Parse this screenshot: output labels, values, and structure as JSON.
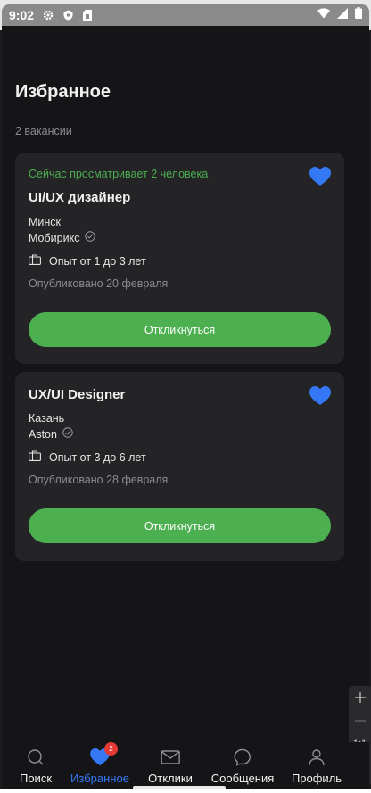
{
  "status_bar": {
    "time": "9:02",
    "left_icons": [
      "gear-icon",
      "shield-icon",
      "sim-card-icon"
    ],
    "right_icons": [
      "wifi-icon",
      "signal-icon",
      "battery-icon"
    ]
  },
  "page": {
    "title": "Избранное",
    "count": "2 вакансии"
  },
  "vacancies": [
    {
      "viewing": "Сейчас просматривает 2 человека",
      "title": "UI/UX дизайнер",
      "city": "Минск",
      "company": "Мобирикс",
      "experience": "Опыт от 1 до 3 лет",
      "published": "Опубликовано 20 февраля",
      "favorite": true,
      "button": "Откликнуться"
    },
    {
      "title": "UX/UI Designer",
      "city": "Казань",
      "company": "Aston",
      "experience": "Опыт от 3 до 6 лет",
      "published": "Опубликовано 28 февраля",
      "favorite": true,
      "button": "Откликнуться"
    }
  ],
  "zoom_panel": {
    "ratio": "1:1"
  },
  "bottom_nav": {
    "items": [
      {
        "label": "Поиск",
        "icon": "search-icon"
      },
      {
        "label": "Избранное",
        "icon": "heart-icon",
        "badge": "2",
        "active": true
      },
      {
        "label": "Отклики",
        "icon": "envelope-icon"
      },
      {
        "label": "Сообщения",
        "icon": "chat-bubble-icon"
      },
      {
        "label": "Профиль",
        "icon": "person-icon"
      }
    ]
  },
  "colors": {
    "accent_green": "#4caf50",
    "accent_blue": "#3478f6",
    "background": "#151518",
    "card": "#242427",
    "badge_red": "#e53935"
  }
}
